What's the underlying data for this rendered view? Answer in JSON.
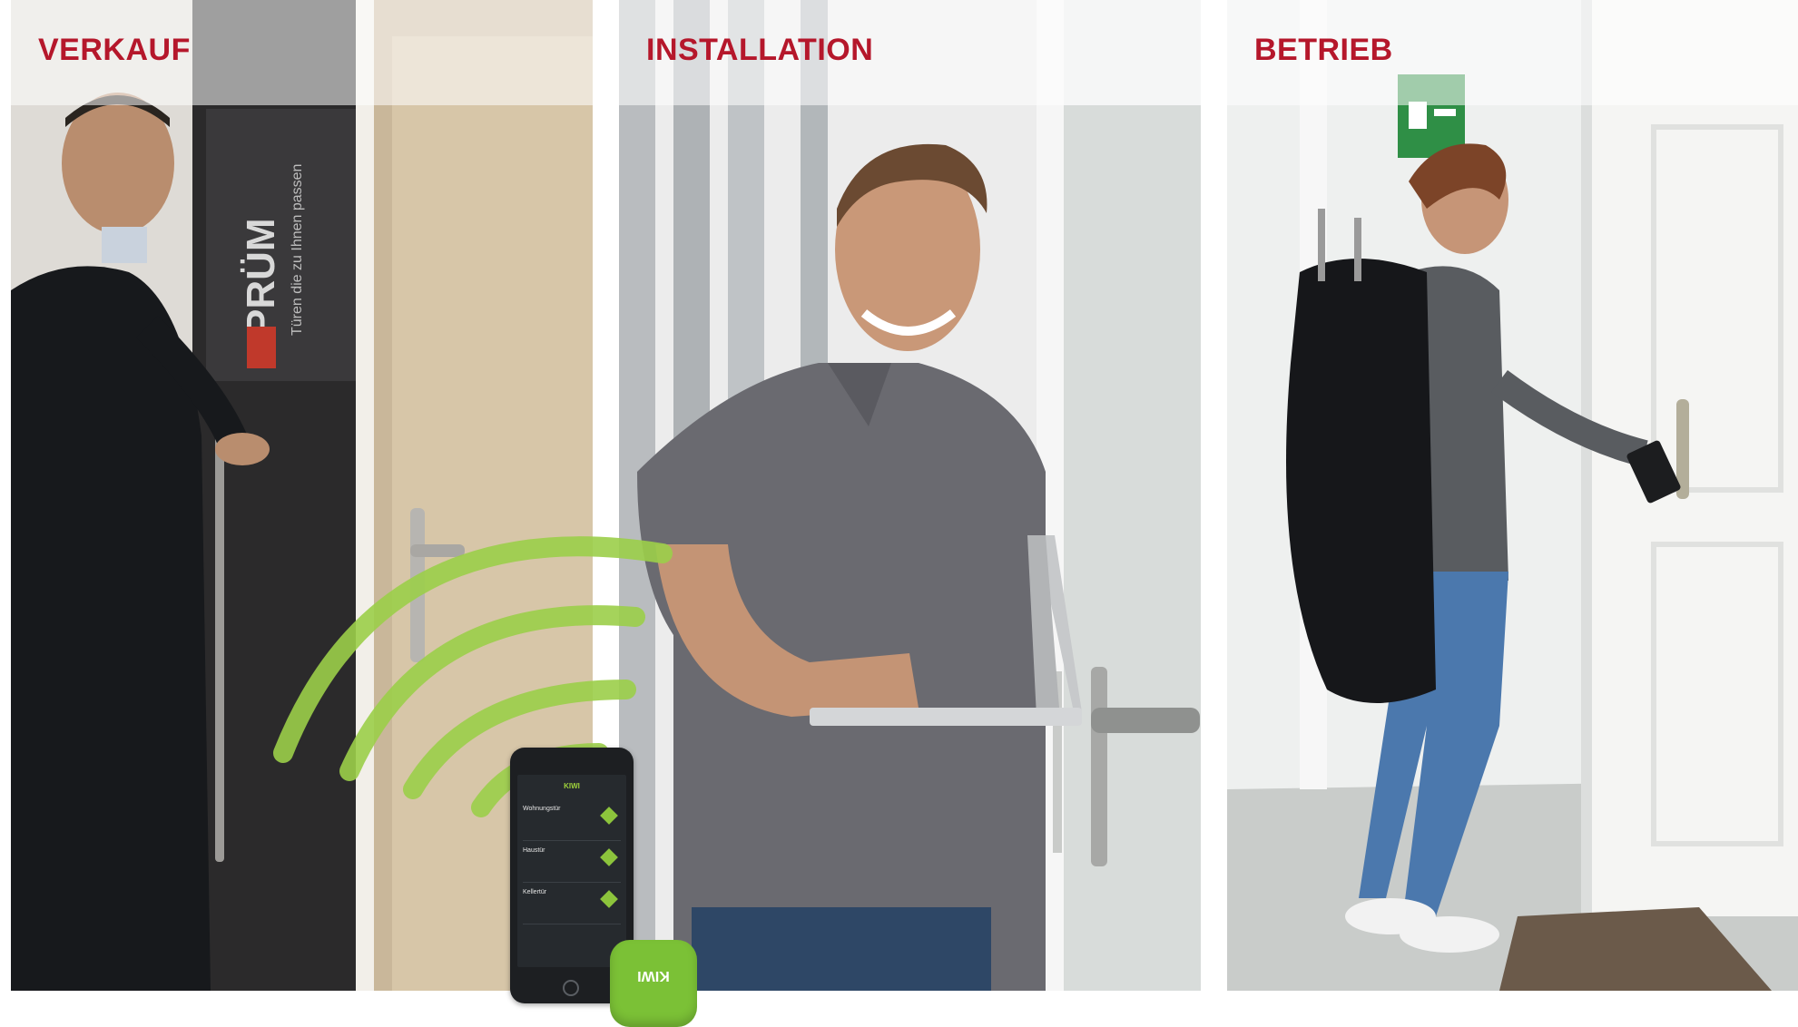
{
  "panels": [
    {
      "id": "verkauf",
      "label": "VERKAUF",
      "label_color": "#b5172b"
    },
    {
      "id": "installation",
      "label": "INSTALLATION",
      "label_color": "#b5172b"
    },
    {
      "id": "betrieb",
      "label": "BETRIEB",
      "label_color": "#b5172b"
    }
  ],
  "door_sign": {
    "brand": "PRÜM",
    "slogan": "Türen die zu Ihnen passen"
  },
  "phone_app": {
    "brand": "KIWI",
    "items": [
      "Wohnungstür",
      "Haustür",
      "Kellertür"
    ]
  },
  "tag": {
    "brand": "KIWI"
  },
  "colors": {
    "accent_red": "#b5172b",
    "kiwi_green": "#8cc43c",
    "wifi_green": "#9ccf4a"
  }
}
